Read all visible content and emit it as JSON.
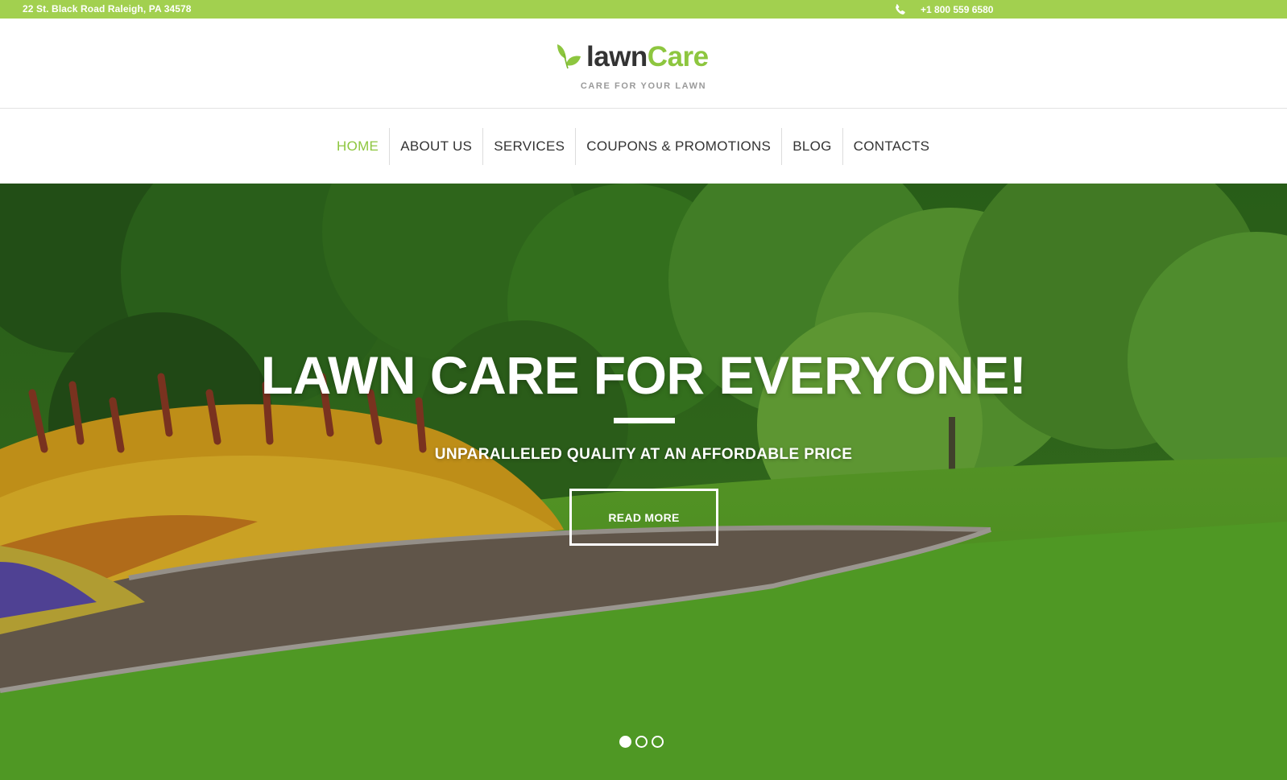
{
  "topbar": {
    "address": "22 St. Black Road Raleigh, PA 34578",
    "phone": "+1 800 559 6580",
    "background": "#a2d04f"
  },
  "logo": {
    "word_dark": "lawn",
    "word_green": "Care",
    "tagline": "CARE FOR YOUR LAWN",
    "icon": "leaf-icon"
  },
  "nav": {
    "items": [
      {
        "label": "HOME",
        "active": true
      },
      {
        "label": "ABOUT US",
        "active": false
      },
      {
        "label": "SERVICES",
        "active": false
      },
      {
        "label": "COUPONS & PROMOTIONS",
        "active": false
      },
      {
        "label": "BLOG",
        "active": false
      },
      {
        "label": "CONTACTS",
        "active": false
      }
    ]
  },
  "hero": {
    "title": "LAWN CARE FOR EVERYONE!",
    "subtitle": "UNPARALLELED QUALITY AT AN AFFORDABLE PRICE",
    "button": "READ MORE",
    "slides": 3,
    "active_slide": 1
  },
  "colors": {
    "accent": "#8dc63f",
    "text_dark": "#333333",
    "white": "#ffffff"
  }
}
